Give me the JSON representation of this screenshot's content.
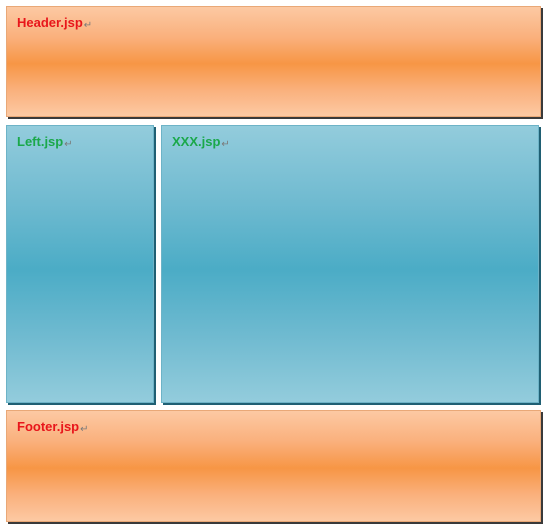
{
  "header": {
    "label": "Header.jsp",
    "mark": "↵"
  },
  "left": {
    "label": "Left.jsp",
    "mark": "↵"
  },
  "main": {
    "label": "XXX.jsp",
    "mark": "↵"
  },
  "footer": {
    "label": "Footer.jsp",
    "mark": "↵"
  },
  "colors": {
    "orange_block": "#f79645",
    "blue_block": "#4bacc6",
    "header_footer_text": "#e8161b",
    "content_text": "#1aa84a"
  }
}
